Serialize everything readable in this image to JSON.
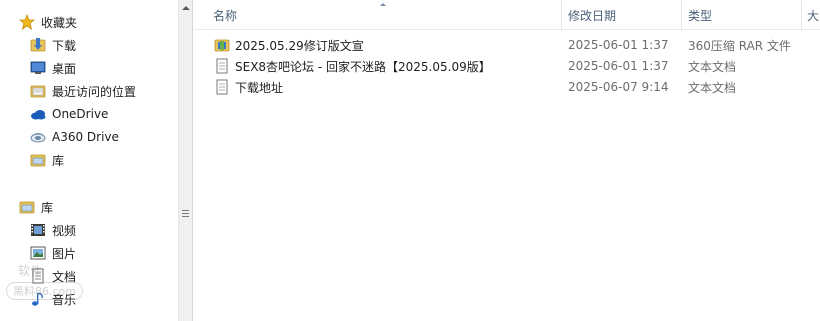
{
  "navigation": {
    "favorites": {
      "label": "收藏夹"
    },
    "items": [
      {
        "label": "下载",
        "icon": "downloads-folder-icon"
      },
      {
        "label": "桌面",
        "icon": "desktop-icon"
      },
      {
        "label": "最近访问的位置",
        "icon": "recent-places-icon"
      },
      {
        "label": "OneDrive",
        "icon": "onedrive-cloud-icon"
      },
      {
        "label": "A360 Drive",
        "icon": "a360-drive-icon"
      },
      {
        "label": "库",
        "icon": "library-folder-icon"
      }
    ],
    "libraries": {
      "label": "库"
    },
    "library_items": [
      {
        "label": "视频",
        "icon": "videos-library-icon"
      },
      {
        "label": "图片",
        "icon": "pictures-library-icon"
      },
      {
        "label": "文档",
        "icon": "documents-library-icon"
      },
      {
        "label": "音乐",
        "icon": "music-library-icon"
      }
    ]
  },
  "columns": {
    "name": "名称",
    "date": "修改日期",
    "type": "类型",
    "size": "大"
  },
  "files": [
    {
      "name": "2025.05.29修订版文宣",
      "date": "2025-06-01 1:37",
      "type": "360压缩 RAR 文件",
      "icon": "rar-archive-icon"
    },
    {
      "name": "SEX8杏吧论坛 - 回家不迷路【2025.05.09版】",
      "date": "2025-06-01 1:37",
      "type": "文本文档",
      "icon": "text-document-icon"
    },
    {
      "name": "下载地址",
      "date": "2025-06-07 9:14",
      "type": "文本文档",
      "icon": "text-document-icon"
    }
  ],
  "watermark": {
    "line1": "软件",
    "line2": "黑料86.com"
  },
  "colors": {
    "header_text": "#4c607a",
    "secondary_text": "#6d6d6d",
    "star": "#f0b81c",
    "folder": "#e8c45c"
  }
}
